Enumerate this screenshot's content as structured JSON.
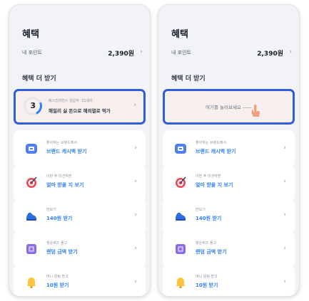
{
  "screens": [
    {
      "title": "혜택",
      "points_label": "내 포인트",
      "points_value": "2,390원",
      "chevron": "›",
      "section_title": "혜택 더 받기",
      "highlight": {
        "step": "3",
        "small": "배스킨라빈스 일곱하 ·31데이",
        "main": "해밀리 싫 돈으로 해외열로 먹가"
      },
      "items": [
        {
          "small": "좋아하는 브랜드에서",
          "main": "브랜드 캐시백 받기",
          "icon": "wallet-icon"
        },
        {
          "small": "이번 주 미션하면",
          "main": "얼마 받을 지 보기",
          "icon": "target-icon"
        },
        {
          "small": "만보기",
          "main": "140원 받기",
          "icon": "sneaker-icon"
        },
        {
          "small": "행운퀴즈 풀고",
          "main": "랜덤 금액 받기",
          "icon": "quiz-icon"
        },
        {
          "small": "머니 알림 받고",
          "main": "10원 받기",
          "icon": "bell-icon"
        }
      ]
    },
    {
      "title": "혜택",
      "points_label": "내 포인트",
      "points_value": "2,390원",
      "chevron": "›",
      "section_title": "혜택 더 받기",
      "highlight": {
        "center_text": "여기를 눌러보세요 ——"
      },
      "items": [
        {
          "small": "좋아하는 브랜드에서",
          "main": "브랜드 캐시백 받기",
          "icon": "wallet-icon"
        },
        {
          "small": "이번 주 미션하면",
          "main": "얼마 받을 지 보기",
          "icon": "target-icon"
        },
        {
          "small": "만보기",
          "main": "140원 받기",
          "icon": "sneaker-icon"
        },
        {
          "small": "행운퀴즈 풀고",
          "main": "랜덤 금액 받기",
          "icon": "quiz-icon"
        },
        {
          "small": "머니 알림 받고",
          "main": "10원 받기",
          "icon": "bell-icon"
        }
      ]
    }
  ],
  "colors": {
    "highlight_border": "#2f5ed9",
    "highlight_bg": "#f7efee",
    "accent_blue": "#3182f6"
  }
}
